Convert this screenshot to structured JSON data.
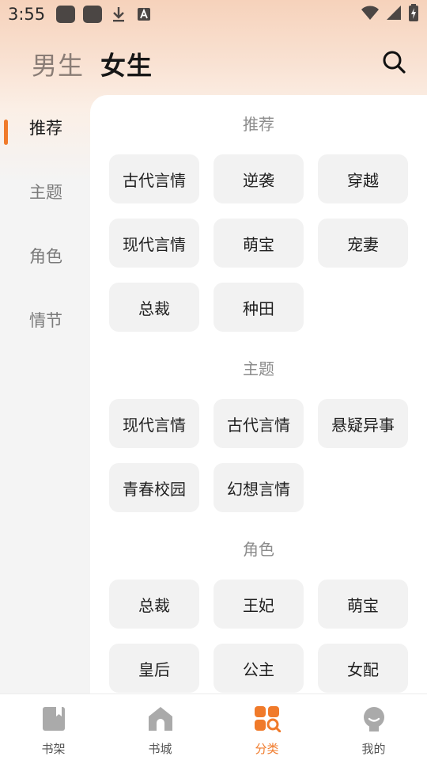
{
  "status_bar": {
    "time": "3:55"
  },
  "header": {
    "tabs": [
      {
        "label": "男生",
        "active": false
      },
      {
        "label": "女生",
        "active": true
      }
    ]
  },
  "sidebar": {
    "items": [
      {
        "label": "推荐",
        "active": true
      },
      {
        "label": "主题",
        "active": false
      },
      {
        "label": "角色",
        "active": false
      },
      {
        "label": "情节",
        "active": false
      }
    ]
  },
  "sections": [
    {
      "title": "推荐",
      "tags": [
        "古代言情",
        "逆袭",
        "穿越",
        "现代言情",
        "萌宝",
        "宠妻",
        "总裁",
        "种田"
      ]
    },
    {
      "title": "主题",
      "tags": [
        "现代言情",
        "古代言情",
        "悬疑异事",
        "青春校园",
        "幻想言情"
      ]
    },
    {
      "title": "角色",
      "tags": [
        "总裁",
        "王妃",
        "萌宝",
        "皇后",
        "公主",
        "女配"
      ]
    }
  ],
  "bottom_nav": {
    "items": [
      {
        "label": "书架",
        "icon": "bookshelf-icon",
        "active": false
      },
      {
        "label": "书城",
        "icon": "bookstore-icon",
        "active": false
      },
      {
        "label": "分类",
        "icon": "category-icon",
        "active": true
      },
      {
        "label": "我的",
        "icon": "profile-icon",
        "active": false
      }
    ]
  },
  "colors": {
    "accent": "#f07a2a",
    "chip_bg": "#f2f2f2",
    "muted_text": "#8c8c8c"
  }
}
